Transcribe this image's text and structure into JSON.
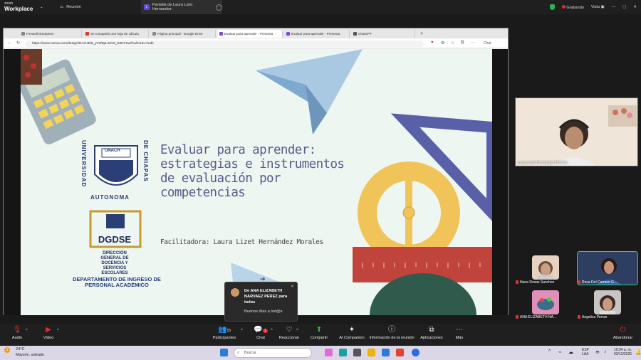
{
  "zoom": {
    "brand_small": "zoom",
    "brand_big": "Workplace",
    "tabs": [
      {
        "label": "Reunión"
      },
      {
        "label": "Pantalla de Laura Lizet Hernandez",
        "badge": "L"
      }
    ],
    "recording": "Grabando",
    "view": "Vista"
  },
  "browser": {
    "tabs": [
      "Firewall Disclaimer",
      "Se compartió una hoja de cálculo",
      "Página principal - Google Drive",
      "Evaluar para aprender - Presenta",
      "Evaluar para aprender - Presenta",
      "ChatGPT"
    ],
    "new_tab": "+",
    "url": "https://www.canva.com/design/DAG4DB_yV0/9pL3mW_83HFSw/hod%UKA/edit",
    "chat_label": "Chat"
  },
  "slide": {
    "title": "Evaluar para aprender: estrategias e instrumentos de evaluación por competencias",
    "facilitator": "Facilitadora: Laura Lizet Hernández Morales",
    "unach_left": "UNIVERSIDAD",
    "unach_right": "DE CHIAPAS",
    "unach_bottom": "AUTONOMA",
    "unach_seal": "UNACH",
    "dgdse_logo": "DGDSE",
    "dgdse_name": "DIRECCIÓN GENERAL DE DOCENCIA Y SERVICIOS ESCOLARES",
    "department": "DEPARTAMENTO DE INGRESO DE PERSONAL ACADÉMICO"
  },
  "chat_toast": {
    "from": "De ANA ELIZABETH NARVAEZ PEREZ para todos",
    "message": "Buenos días a tod@s"
  },
  "participants": {
    "speaker": "Laura Lizet Hernandez Morales",
    "thumbs": [
      "Iliana Rosas Sanchez",
      "Rosa Del Carmen G...",
      "ANA ELIZABETH NA...",
      "Angelica Perras"
    ]
  },
  "toolbar": {
    "audio": "Audio",
    "video": "Vídeo",
    "participants": "Participantes",
    "participants_count": "15",
    "chat": "Chat",
    "chat_badge": "1",
    "react": "Reaccionar",
    "share": "Compartir",
    "ai": "AI Companion",
    "info": "Información de la reunión",
    "apps": "Aplicaciones",
    "more": "Más",
    "leave": "Abandonar"
  },
  "taskbar": {
    "weather_temp": "24°C",
    "weather_desc": "Mayorm. soleado",
    "search_placeholder": "Buscar",
    "lang": "ESP",
    "lang2": "LAA",
    "time": "10:04 a. m.",
    "date": "03/12/2025",
    "notif": "1"
  },
  "colors": {
    "zoom_bg": "#1f1f1f",
    "slide_bg": "#eef6f2",
    "title_color": "#5a5a8c",
    "share_green": "#2fb24c",
    "leave_red": "#e0312f"
  }
}
